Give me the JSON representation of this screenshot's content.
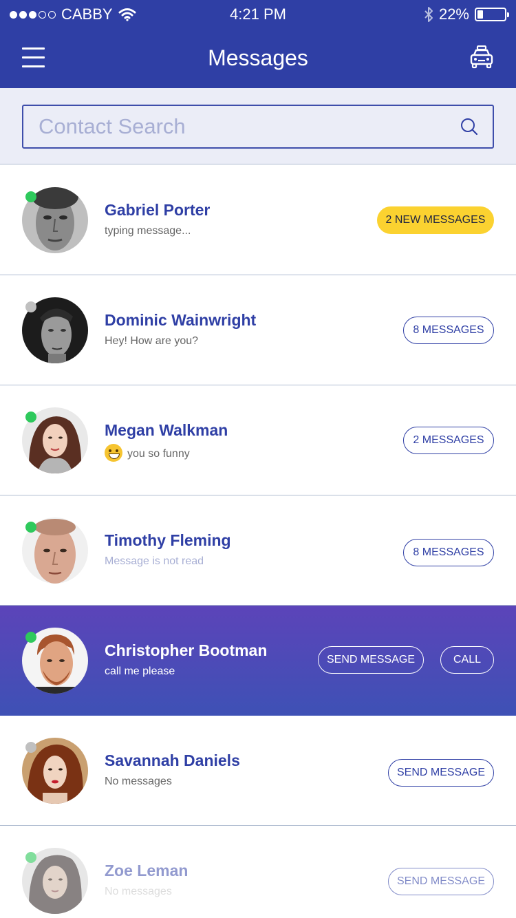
{
  "status_bar": {
    "carrier": "CABBY",
    "time": "4:21 PM",
    "battery": "22%",
    "battery_level": 0.22
  },
  "header": {
    "title": "Messages",
    "menu_icon": "hamburger-menu-icon",
    "right_icon": "taxi-icon"
  },
  "search": {
    "placeholder": "Contact Search",
    "value": ""
  },
  "colors": {
    "primary": "#2f3fa5",
    "online": "#2ec95c",
    "offline": "#c0c0c0",
    "highlight": "#fbd230"
  },
  "contacts": [
    {
      "name": "Gabriel Porter",
      "message": "typing message...",
      "status": "online",
      "action": "2 NEW MESSAGES"
    },
    {
      "name": "Dominic Wainwright",
      "message": "Hey! How are you?",
      "status": "offline",
      "action": "8 MESSAGES"
    },
    {
      "name": "Megan Walkman",
      "message": "you so funny",
      "status": "online",
      "action": "2 MESSAGES"
    },
    {
      "name": "Timothy Fleming",
      "message": "Message is not read",
      "status": "online",
      "action": "8 MESSAGES"
    },
    {
      "name": "Christopher Bootman",
      "message": "call me please",
      "status": "online",
      "action": "SEND MESSAGE",
      "action2": "CALL"
    },
    {
      "name": "Savannah Daniels",
      "message": "No messages",
      "status": "offline",
      "action": "SEND MESSAGE"
    },
    {
      "name": "Zoe Leman",
      "message": "No messages",
      "status": "online",
      "action": "SEND MESSAGE"
    }
  ]
}
